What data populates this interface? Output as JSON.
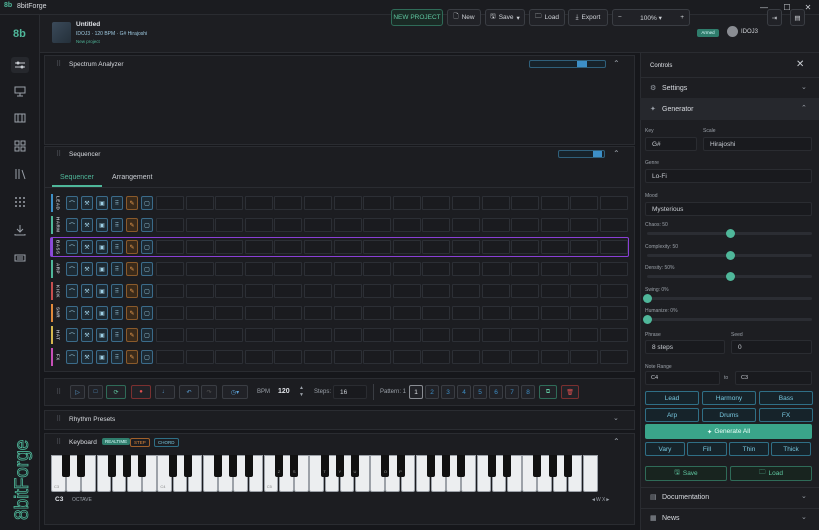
{
  "window": {
    "title": "8bitForge",
    "controls": [
      "minimize-icon",
      "maximize-icon",
      "close-icon"
    ]
  },
  "project": {
    "name": "Untitled",
    "details": "IDOJ3 · 120 BPM · G# Hirajoshi",
    "badge": "New project"
  },
  "topbar": {
    "new_project": "NEW PROJECT",
    "new": "New",
    "save": "Save",
    "load": "Load",
    "export": "Export",
    "zoom": "100%",
    "zoom_minus": "−",
    "zoom_plus": "+",
    "status": "Armed",
    "user": "IDOJ3"
  },
  "spectrum": {
    "title": "Spectrum Analyzer"
  },
  "sequencer": {
    "title": "Sequencer",
    "tabs": [
      "Sequencer",
      "Arrangement"
    ],
    "tracks": [
      {
        "name": "LEAD",
        "color": "#3d8fc7"
      },
      {
        "name": "HARM",
        "color": "#4fb79a"
      },
      {
        "name": "BASS",
        "color": "#8a4fd6"
      },
      {
        "name": "ARP",
        "color": "#4fb79a"
      },
      {
        "name": "KICK",
        "color": "#c74f4f"
      },
      {
        "name": "SNR",
        "color": "#e08a3c"
      },
      {
        "name": "HAT",
        "color": "#d6b84f"
      },
      {
        "name": "FX",
        "color": "#c74fb7"
      }
    ]
  },
  "transport": {
    "bpm_label": "BPM",
    "bpm": "120",
    "steps_label": "Steps:",
    "steps": "16",
    "pattern_label": "Pattern: 1",
    "patterns": [
      "1",
      "2",
      "3",
      "4",
      "5",
      "6",
      "7",
      "8"
    ]
  },
  "rhythm": {
    "title": "Rhythm Presets"
  },
  "keyboard": {
    "title": "Keyboard",
    "modes": [
      "REALTIME",
      "STEP",
      "CHORD"
    ],
    "octave_value": "C3",
    "octave_label": "OCTAVE",
    "nav": "◄W  X►",
    "key_labels": [
      "C3",
      "C4",
      "C5"
    ],
    "black_labels": [
      "Z",
      "S",
      "T",
      "Y",
      "U",
      "O",
      "P"
    ]
  },
  "controls": {
    "title": "Controls",
    "settings": "Settings",
    "generator": "Generator",
    "key_label": "Key",
    "key": "G#",
    "scale_label": "Scale",
    "scale": "Hirajoshi",
    "genre_label": "Genre",
    "genre": "Lo-Fi",
    "mood_label": "Mood",
    "mood": "Mysterious",
    "sliders": [
      {
        "label": "Chaos: 50",
        "value": 0.5
      },
      {
        "label": "Complexity: 50",
        "value": 0.5
      },
      {
        "label": "Density: 50%",
        "value": 0.5
      },
      {
        "label": "Swing: 0%",
        "value": 0
      },
      {
        "label": "Humanize: 0%",
        "value": 0
      }
    ],
    "phrase_label": "Phrase",
    "phrase": "8 steps",
    "seed_label": "Seed",
    "seed": "0",
    "note_range_label": "Note Range",
    "range_low": "C4",
    "range_to": "to",
    "range_high": "C3",
    "instrument_buttons": [
      "Lead",
      "Harmony",
      "Bass",
      "Arp",
      "Drums",
      "FX"
    ],
    "generate_all": "Generate All",
    "variations": [
      "Vary",
      "Fill",
      "Thin",
      "Thick"
    ],
    "save": "Save",
    "load": "Load",
    "documentation": "Documentation",
    "news": "News"
  }
}
